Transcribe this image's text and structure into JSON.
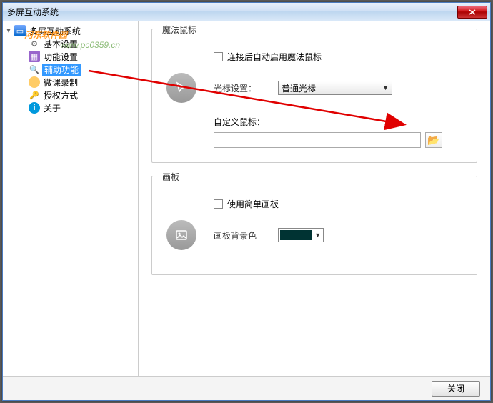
{
  "window": {
    "title": "多屏互动系统"
  },
  "watermark": {
    "main": "河东软件园",
    "sub": "www.pc0359.cn"
  },
  "tree": {
    "root": "多屏互动系统",
    "items": [
      {
        "label": "基本设置"
      },
      {
        "label": "功能设置"
      },
      {
        "label": "辅助功能",
        "selected": true
      },
      {
        "label": "微课录制"
      },
      {
        "label": "授权方式"
      },
      {
        "label": "关于"
      }
    ]
  },
  "content": {
    "group1": {
      "title": "魔法鼠标",
      "checkbox": "连接后自动启用魔法鼠标",
      "cursor_label": "光标设置：",
      "cursor_value": "普通光标",
      "custom_label": "自定义鼠标："
    },
    "group2": {
      "title": "画板",
      "checkbox": "使用简单画板",
      "bg_label": "画板背景色",
      "bg_color": "#003333"
    }
  },
  "footer": {
    "close": "关闭"
  }
}
